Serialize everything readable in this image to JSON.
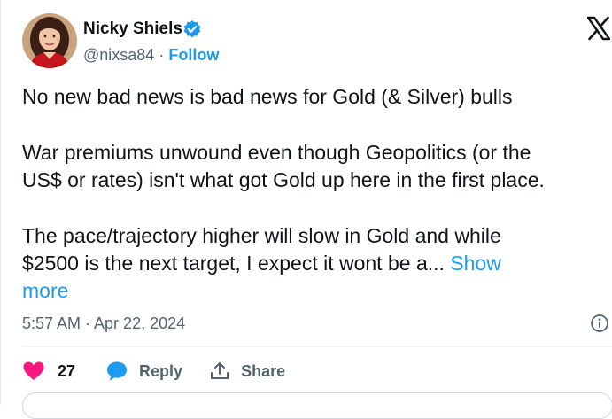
{
  "author": {
    "name": "Nicky Shiels",
    "handle": "@nixsa84",
    "separator": "·",
    "follow_label": "Follow"
  },
  "tweet": {
    "line1": "No new bad news is bad news for Gold (& Silver) bulls",
    "line2": "War premiums unwound even though Geopolitics (or the",
    "line3": "US$ or rates) isn't what got Gold up here in the first place.",
    "line4": "The pace/trajectory higher will slow in Gold and while",
    "line5": "$2500 is the next target,  I expect it wont be a...",
    "show_more_part1": "Show",
    "show_more_part2": "more"
  },
  "meta": {
    "timestamp": "5:57 AM · Apr 22, 2024"
  },
  "actions": {
    "like_count": "27",
    "reply_label": "Reply",
    "share_label": "Share"
  },
  "colors": {
    "accent": "#1d9bf0",
    "like": "#f91880",
    "secondary_text": "#536471"
  },
  "icons": {
    "verified": "verified-badge-icon",
    "platform": "x-logo-icon",
    "info": "info-icon",
    "like": "heart-icon",
    "reply": "speech-bubble-icon",
    "share": "share-upload-icon"
  }
}
